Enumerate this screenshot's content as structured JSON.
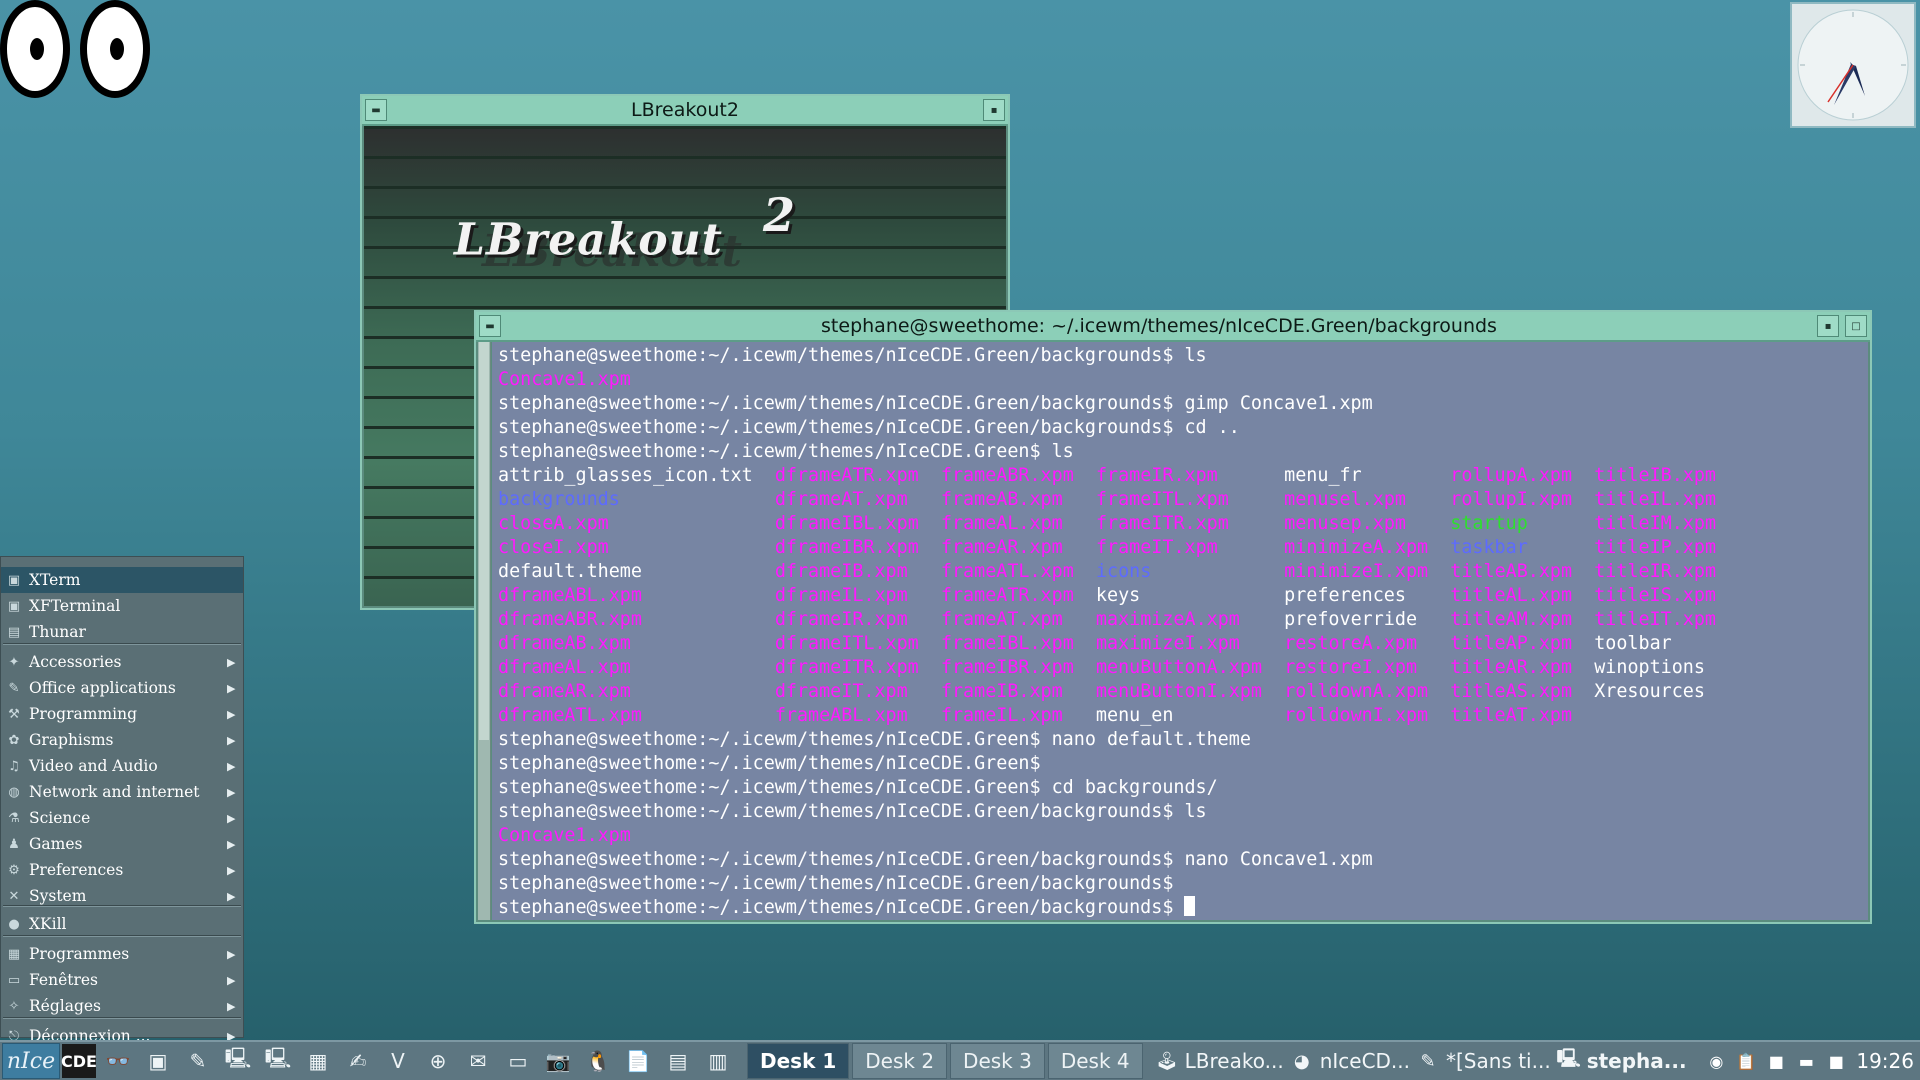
{
  "colors": {
    "desktop": "#3f8798",
    "window_frame": "#8ccfb8",
    "terminal_bg": "#7785a3",
    "ls_file": "#ff19ff",
    "ls_dir": "#5d6bff",
    "ls_exec": "#2ee02e",
    "menu_bg": "#5a6f75",
    "menu_selected": "#2c5566",
    "taskbar": "#5d7681"
  },
  "breakout_window": {
    "title": "LBreakout2",
    "logo_text": "LBreakout",
    "logo_sup": "2"
  },
  "terminal": {
    "title": "stephane@sweethome: ~/.icewm/themes/nIceCDE.Green/backgrounds",
    "lines": [
      "stephane@sweethome:~/.icewm/themes/nIceCDE.Green/backgrounds$ ls",
      "Concave1.xpm",
      "stephane@sweethome:~/.icewm/themes/nIceCDE.Green/backgrounds$ gimp Concave1.xpm",
      "stephane@sweethome:~/.icewm/themes/nIceCDE.Green/backgrounds$ cd ..",
      "stephane@sweethome:~/.icewm/themes/nIceCDE.Green$ ls",
      "attrib_glasses_icon.txt  dframeATR.xpm  frameABR.xpm  frameIR.xpm      menu_fr        rollupA.xpm  titleIB.xpm",
      "backgrounds              dframeAT.xpm   frameAB.xpm   frameITL.xpm     menusel.xpm    rollupI.xpm  titleIL.xpm",
      "closeA.xpm               dframeIBL.xpm  frameAL.xpm   frameITR.xpm     menusep.xpm    startup      titleIM.xpm",
      "closeI.xpm               dframeIBR.xpm  frameAR.xpm   frameIT.xpm      minimizeA.xpm  taskbar      titleIP.xpm",
      "default.theme            dframeIB.xpm   frameATL.xpm  icons            minimizeI.xpm  titleAB.xpm  titleIR.xpm",
      "dframeABL.xpm            dframeIL.xpm   frameATR.xpm  keys             preferences    titleAL.xpm  titleIS.xpm",
      "dframeABR.xpm            dframeIR.xpm   frameAT.xpm   maximizeA.xpm    prefoverride   titleAM.xpm  titleIT.xpm",
      "dframeAB.xpm             dframeITL.xpm  frameIBL.xpm  maximizeI.xpm    restoreA.xpm   titleAP.xpm  toolbar",
      "dframeAL.xpm             dframeITR.xpm  frameIBR.xpm  menuButtonA.xpm  restoreI.xpm   titleAR.xpm  winoptions",
      "dframeAR.xpm             dframeIT.xpm   frameIB.xpm   menuButtonI.xpm  rolldownA.xpm  titleAS.xpm  Xresources",
      "dframeATL.xpm            frameABL.xpm   frameIL.xpm   menu_en          rolldownI.xpm  titleAT.xpm",
      "stephane@sweethome:~/.icewm/themes/nIceCDE.Green$ nano default.theme",
      "stephane@sweethome:~/.icewm/themes/nIceCDE.Green$",
      "stephane@sweethome:~/.icewm/themes/nIceCDE.Green$ cd backgrounds/",
      "stephane@sweethome:~/.icewm/themes/nIceCDE.Green/backgrounds$ ls",
      "Concave1.xpm",
      "stephane@sweethome:~/.icewm/themes/nIceCDE.Green/backgrounds$ nano Concave1.xpm",
      "stephane@sweethome:~/.icewm/themes/nIceCDE.Green/backgrounds$",
      "stephane@sweethome:~/.icewm/themes/nIceCDE.Green/backgrounds$ "
    ],
    "colored_words": {
      "magenta": [
        "Concave1.xpm",
        "closeA.xpm",
        "closeI.xpm",
        "dframeABL.xpm",
        "dframeABR.xpm",
        "dframeAB.xpm",
        "dframeAL.xpm",
        "dframeAR.xpm",
        "dframeATL.xpm",
        "dframeATR.xpm",
        "dframeAT.xpm",
        "dframeIBL.xpm",
        "dframeIBR.xpm",
        "dframeIB.xpm",
        "dframeIL.xpm",
        "dframeIR.xpm",
        "dframeITL.xpm",
        "dframeITR.xpm",
        "dframeIT.xpm",
        "frameABL.xpm",
        "frameABR.xpm",
        "frameAB.xpm",
        "frameAL.xpm",
        "frameAR.xpm",
        "frameATL.xpm",
        "frameATR.xpm",
        "frameAT.xpm",
        "frameIBL.xpm",
        "frameIBR.xpm",
        "frameIB.xpm",
        "frameIL.xpm",
        "frameIR.xpm",
        "frameITL.xpm",
        "frameITR.xpm",
        "frameIT.xpm",
        "maximizeA.xpm",
        "maximizeI.xpm",
        "menuButtonA.xpm",
        "menuButtonI.xpm",
        "menusel.xpm",
        "menusep.xpm",
        "minimizeA.xpm",
        "minimizeI.xpm",
        "restoreA.xpm",
        "restoreI.xpm",
        "rolldownA.xpm",
        "rolldownI.xpm",
        "rollupA.xpm",
        "rollupI.xpm",
        "titleAB.xpm",
        "titleAL.xpm",
        "titleAM.xpm",
        "titleAP.xpm",
        "titleAR.xpm",
        "titleAS.xpm",
        "titleAT.xpm",
        "titleIB.xpm",
        "titleIL.xpm",
        "titleIM.xpm",
        "titleIP.xpm",
        "titleIR.xpm",
        "titleIS.xpm",
        "titleIT.xpm"
      ],
      "blue": [
        "backgrounds",
        "icons",
        "taskbar"
      ],
      "green": [
        "startup"
      ]
    }
  },
  "start_menu": {
    "items": [
      {
        "label": "XTerm",
        "icon": "terminal-icon",
        "submenu": false,
        "selected": true
      },
      {
        "label": "XFTerminal",
        "icon": "terminal-icon",
        "submenu": false
      },
      {
        "label": "Thunar",
        "icon": "file-manager-icon",
        "submenu": false
      },
      {
        "label": "Accessories",
        "icon": "accessories-icon",
        "submenu": true
      },
      {
        "label": "Office applications",
        "icon": "office-icon",
        "submenu": true
      },
      {
        "label": "Programming",
        "icon": "programming-icon",
        "submenu": true
      },
      {
        "label": "Graphisms",
        "icon": "graphics-icon",
        "submenu": true
      },
      {
        "label": "Video and Audio",
        "icon": "multimedia-icon",
        "submenu": true
      },
      {
        "label": "Network and internet",
        "icon": "network-icon",
        "submenu": true
      },
      {
        "label": "Science",
        "icon": "science-icon",
        "submenu": true
      },
      {
        "label": "Games",
        "icon": "games-icon",
        "submenu": true
      },
      {
        "label": "Preferences",
        "icon": "preferences-icon",
        "submenu": true
      },
      {
        "label": "System",
        "icon": "system-icon",
        "submenu": true
      },
      {
        "label": "XKill",
        "icon": "xkill-icon",
        "submenu": false
      },
      {
        "label": "Programmes",
        "icon": "programs-icon",
        "submenu": true
      },
      {
        "label": "Fenêtres",
        "icon": "windows-icon",
        "submenu": true
      },
      {
        "label": "Réglages",
        "icon": "settings-icon",
        "submenu": true
      },
      {
        "label": "Déconnexion ...",
        "icon": "logout-icon",
        "submenu": true
      }
    ]
  },
  "taskbar": {
    "start_label": "nIce",
    "cde_label": "CDE",
    "desks": [
      "Desk 1",
      "Desk 2",
      "Desk 3",
      "Desk 4"
    ],
    "active_desk": "Desk 1",
    "tasks": [
      {
        "label": "LBreako...",
        "icon": "game-icon"
      },
      {
        "label": "nIceCD...",
        "icon": "firefox-icon"
      },
      {
        "label": "*[Sans ti...",
        "icon": "editor-icon"
      },
      {
        "label": "stepha...",
        "icon": "terminal-icon",
        "active": true
      }
    ],
    "clock": "19:26"
  }
}
